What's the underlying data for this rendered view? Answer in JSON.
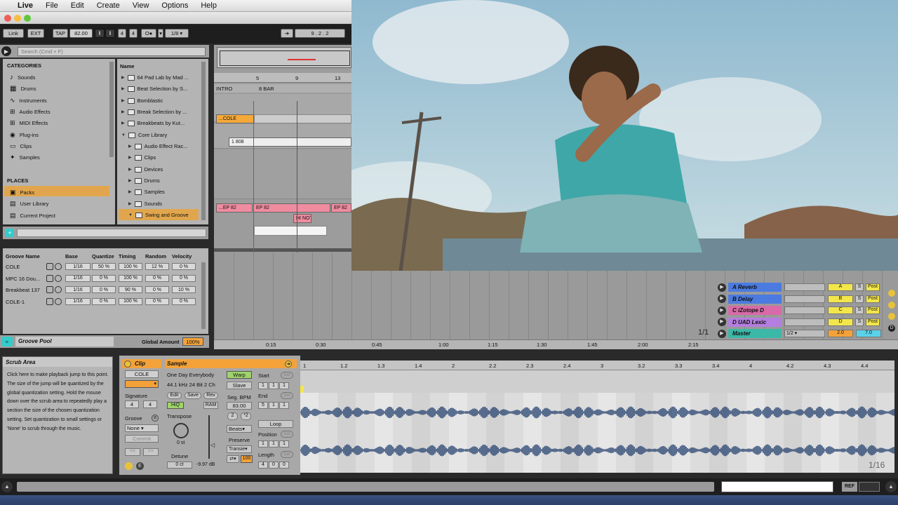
{
  "menubar": {
    "app": "Live",
    "items": [
      "File",
      "Edit",
      "Create",
      "View",
      "Options",
      "Help"
    ]
  },
  "control_bar": {
    "link": "Link",
    "ext": "EXT",
    "tap": "TAP",
    "tempo": "82.00",
    "sig_num": "4",
    "sig_den": "4",
    "quant": "1/8",
    "position": "9 . 2 . 2"
  },
  "browser": {
    "search_placeholder": "Search (Cmd + F)",
    "categories_title": "CATEGORIES",
    "categories": [
      "Sounds",
      "Drums",
      "Instruments",
      "Audio Effects",
      "MIDI Effects",
      "Plug-ins",
      "Clips",
      "Samples"
    ],
    "places_title": "PLACES",
    "places": [
      "Packs",
      "User Library",
      "Current Project"
    ],
    "name_header": "Name",
    "files": [
      "64 Pad Lab by Mad ...",
      "Beat Selection by S...",
      "Bomblastic",
      "Break Selection by ...",
      "Breakbeats by Kut...",
      "Core Library",
      "Audio Effect Rac...",
      "Clips",
      "Devices",
      "Drums",
      "Samples",
      "Sounds",
      "Swing and Groove"
    ]
  },
  "groove_pool": {
    "headers": [
      "Groove Name",
      "Base",
      "Quantize",
      "Timing",
      "Random",
      "Velocity"
    ],
    "rows": [
      {
        "name": "COLE",
        "base": "1/16",
        "quantize": "50 %",
        "timing": "100 %",
        "random": "12 %",
        "velocity": "0 %"
      },
      {
        "name": "MPC 16 Dou...",
        "base": "1/16",
        "quantize": "0 %",
        "timing": "100 %",
        "random": "0 %",
        "velocity": "0 %"
      },
      {
        "name": "Breakbeat 137",
        "base": "1/16",
        "quantize": "0 %",
        "timing": "90 %",
        "random": "0 %",
        "velocity": "10 %"
      },
      {
        "name": "COLE-1",
        "base": "1/16",
        "quantize": "0 %",
        "timing": "100 %",
        "random": "0 %",
        "velocity": "0 %"
      }
    ],
    "footer_label": "Groove Pool",
    "global_amount_label": "Global Amount",
    "global_amount": "100%"
  },
  "arrangement": {
    "bar_numbers": [
      "5",
      "9",
      "13"
    ],
    "locators": [
      "INTRO",
      "8 BAR"
    ],
    "clips": {
      "cole": "...COLE",
      "808": "1 808",
      "ep1": "...EP 82",
      "ep2": "EP 82",
      "ep3": "EP 82",
      "hat": "HI NOT"
    },
    "returns": [
      {
        "name": "A Reverb",
        "send": "A",
        "color": "#4b7be0"
      },
      {
        "name": "B Delay",
        "send": "B",
        "color": "#4b7be0"
      },
      {
        "name": "C iZotope D",
        "send": "C",
        "color": "#d86aa8"
      },
      {
        "name": "D UAD Lexic",
        "send": "D",
        "color": "#b47de0"
      }
    ],
    "master": {
      "name": "Master",
      "routing": "1/2",
      "vol1": "2.0",
      "vol2": "7.0"
    },
    "post": "Post",
    "solo": "S",
    "zoom": "1/1",
    "times": [
      "0:15",
      "0:30",
      "0:45",
      "1:00",
      "1:15",
      "1:30",
      "1:45",
      "2:00",
      "2:15"
    ]
  },
  "scrub_info": {
    "title": "Scrub Area",
    "text": "Click here to make playback jump to this point. The size of the jump will be quantized by the global quantization setting. Hold the mouse down over the scrub area to repeatedly play a section the size of the chosen quantization setting. Set quantization to small settings or 'None' to scrub through the music."
  },
  "clip_view": {
    "clip_title": "Clip",
    "clip_name": "COLE",
    "signature_label": "Signature",
    "sig_num": "4",
    "sig_den": "4",
    "groove_label": "Groove",
    "groove_value": "None",
    "commit": "Commit",
    "sample_title": "Sample",
    "sample_name": "One Day Everybody",
    "sample_info": "44.1 kHz 24 Bit 2 Ch",
    "edit": "Edit",
    "save": "Save",
    "rev": "Rev",
    "hiq": "HiQ",
    "ram": "RAM",
    "transpose_label": "Transpose",
    "transpose_value": "0 st",
    "detune_label": "Detune",
    "detune_value": "0 ct",
    "gain_value": "-9.97 dB",
    "warp": "Warp",
    "slave": "Slave",
    "seg_bpm_label": "Seg. BPM",
    "seg_bpm": "83.00",
    "half": "2",
    "double": "*2",
    "beats": "Beats",
    "preserve_label": "Preserve",
    "transients": "Transie",
    "loop_pct": "100",
    "start_label": "Start",
    "end_label": "End",
    "loop_btn": "Loop",
    "position_label": "Position",
    "length_label": "Length",
    "set": "Set",
    "start_vals": [
      "1",
      "1",
      "1"
    ],
    "end_vals": [
      "5",
      "1",
      "1"
    ],
    "position_vals": [
      "1",
      "1",
      "1"
    ],
    "length_vals": [
      "4",
      "0",
      "0"
    ]
  },
  "sample_editor": {
    "ruler": [
      "1",
      "1.2",
      "1.3",
      "1.4",
      "2",
      "2.2",
      "2.3",
      "2.4",
      "3",
      "3.2",
      "3.3",
      "3.4",
      "4",
      "4.2",
      "4.3",
      "4.4"
    ],
    "zoom": "1/16"
  },
  "status": {
    "ref": "REF"
  }
}
